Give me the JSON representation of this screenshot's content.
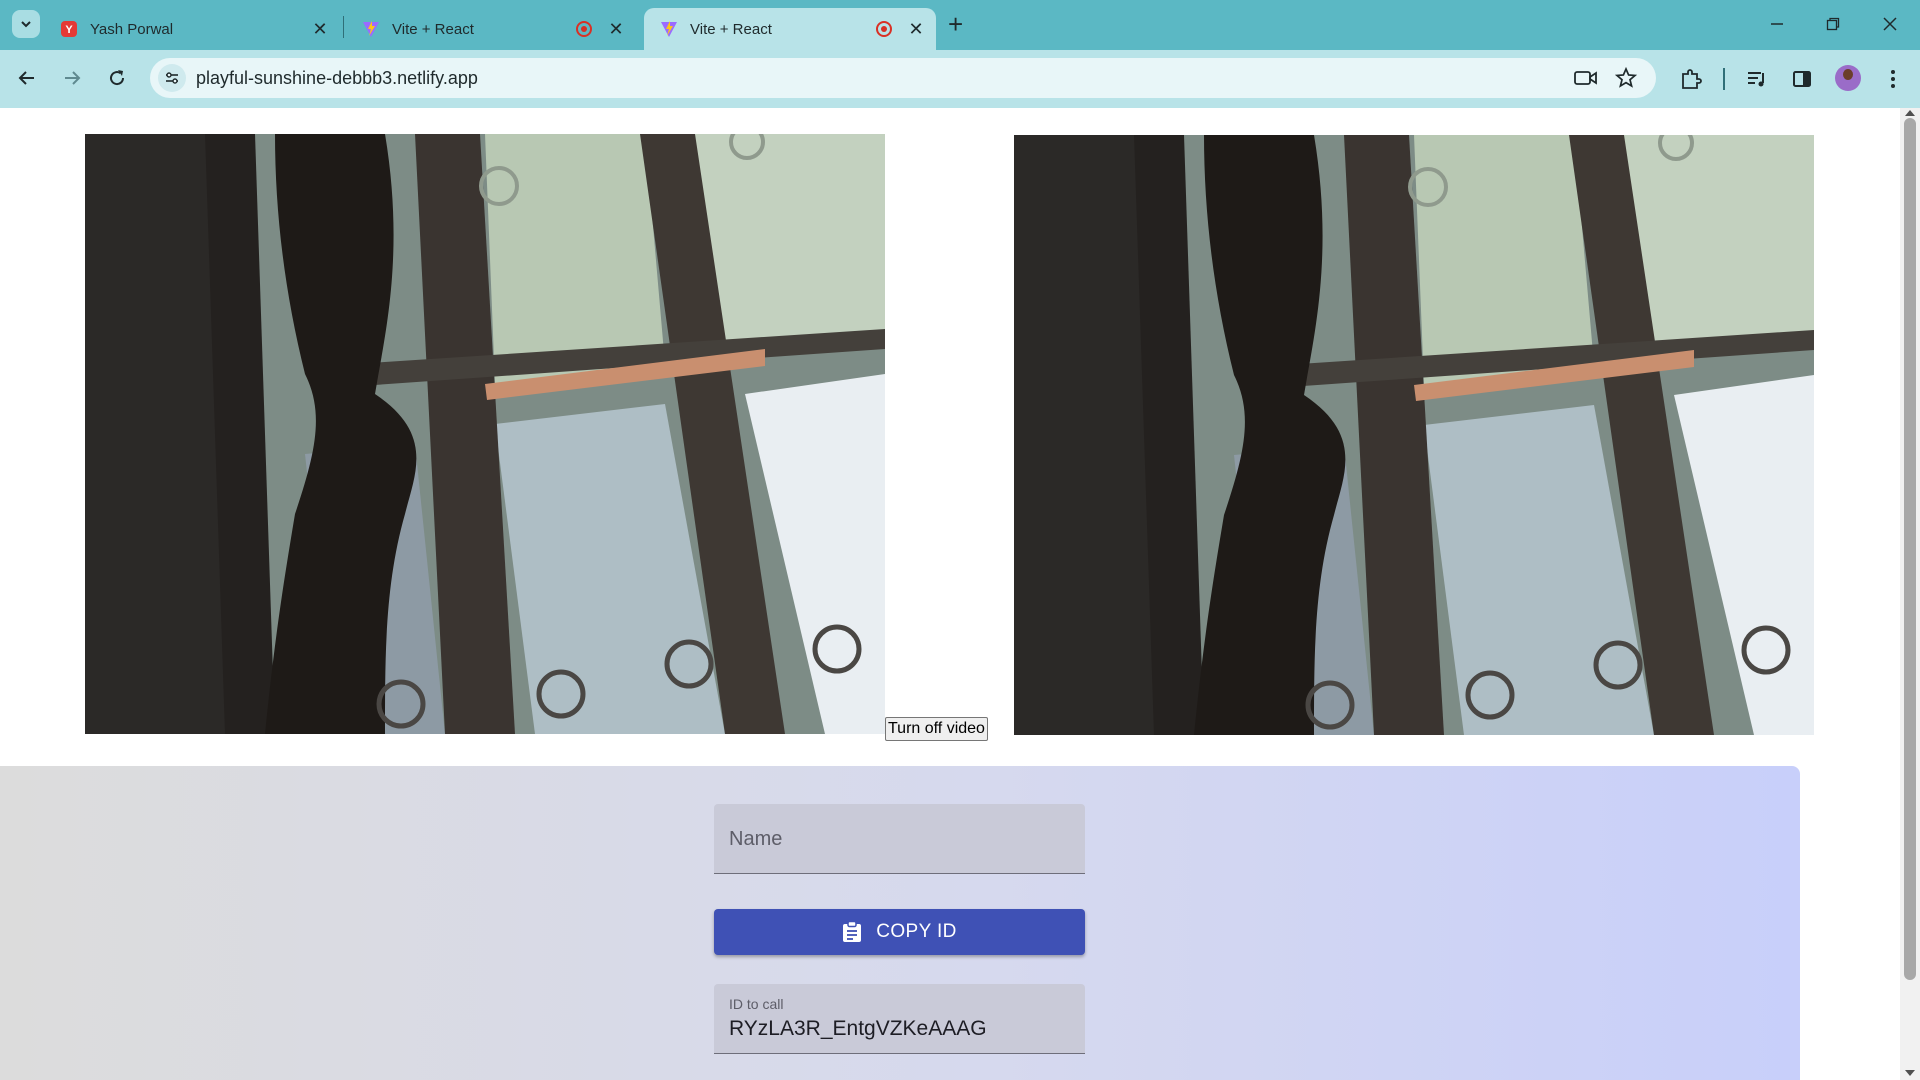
{
  "browser": {
    "tabs": [
      {
        "title": "Yash Porwal",
        "active": false,
        "recording": false
      },
      {
        "title": "Vite + React",
        "active": false,
        "recording": true
      },
      {
        "title": "Vite + React",
        "active": true,
        "recording": true
      }
    ],
    "url": "playful-sunshine-debbb3.netlify.app",
    "colors": {
      "frame": "#5bb8c4",
      "toolbar": "#b8e3e8",
      "omnibox": "#e8f6f8"
    }
  },
  "page": {
    "toggle_video_label": "Turn off video",
    "name_field": {
      "placeholder": "Name",
      "value": ""
    },
    "copy_button_label": "COPY ID",
    "call_field": {
      "label": "ID to call",
      "value": "RYzLA3R_EntgVZKeAAAG"
    },
    "colors": {
      "primary": "#3f51b5"
    }
  }
}
